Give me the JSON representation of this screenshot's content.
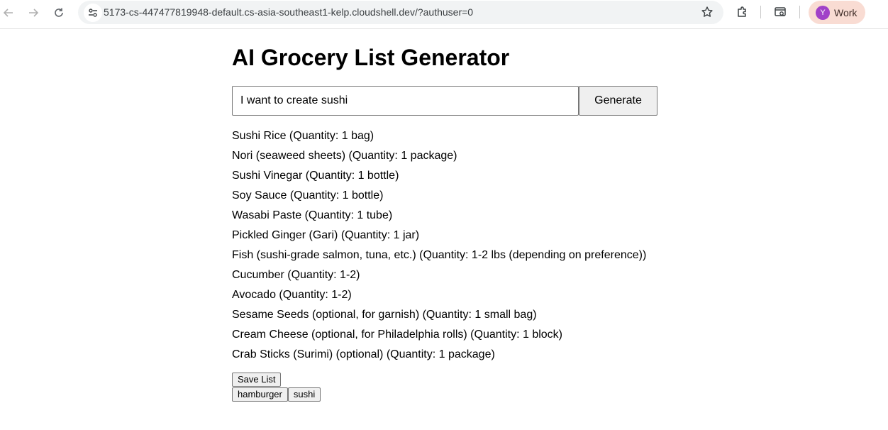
{
  "browser": {
    "url": "5173-cs-447477819948-default.cs-asia-southeast1-kelp.cloudshell.dev/?authuser=0",
    "profile_initial": "Y",
    "profile_label": "Work",
    "icons": [
      "back-arrow-icon",
      "forward-arrow-icon",
      "reload-icon",
      "site-settings-icon",
      "star-icon",
      "extensions-icon",
      "tab-search-icon"
    ]
  },
  "page": {
    "title": "AI Grocery List Generator",
    "prompt_value": "I want to create sushi",
    "generate_label": "Generate",
    "items": [
      "Sushi Rice (Quantity: 1 bag)",
      "Nori (seaweed sheets) (Quantity: 1 package)",
      "Sushi Vinegar (Quantity: 1 bottle)",
      "Soy Sauce (Quantity: 1 bottle)",
      "Wasabi Paste (Quantity: 1 tube)",
      "Pickled Ginger (Gari) (Quantity: 1 jar)",
      "Fish (sushi-grade salmon, tuna, etc.) (Quantity: 1-2 lbs (depending on preference))",
      "Cucumber (Quantity: 1-2)",
      "Avocado (Quantity: 1-2)",
      "Sesame Seeds (optional, for garnish) (Quantity: 1 small bag)",
      "Cream Cheese (optional, for Philadelphia rolls) (Quantity: 1 block)",
      "Crab Sticks (Surimi) (optional) (Quantity: 1 package)"
    ],
    "save_label": "Save List",
    "saved_lists": [
      "hamburger",
      "sushi"
    ]
  },
  "colors": {
    "profile_chip": "#f9dcd3",
    "avatar": "#a142c8",
    "url_bar": "#f1f3f4"
  }
}
